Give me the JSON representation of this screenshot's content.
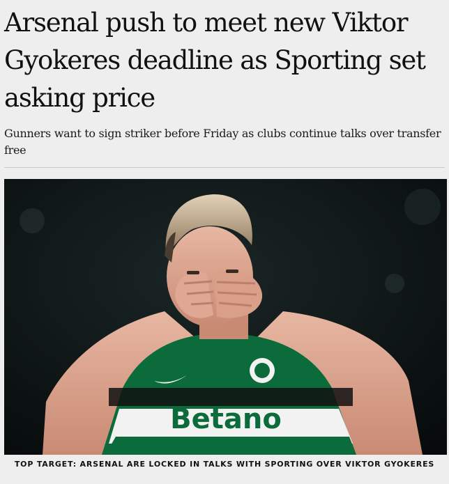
{
  "article": {
    "headline": "Arsenal push to meet new Viktor Gyokeres deadline as Sporting set asking price",
    "standfirst": "Gunners want to sign striker before Friday as clubs continue talks over transfer free",
    "photo": {
      "sponsor_text": "Betano",
      "colors": {
        "kit_green": "#0b6b3a",
        "kit_white": "#f2f2f2",
        "background": "#0b1111"
      }
    },
    "caption": "TOP TARGET: ARSENAL ARE LOCKED IN TALKS WITH SPORTING OVER VIKTOR GYOKERES"
  }
}
